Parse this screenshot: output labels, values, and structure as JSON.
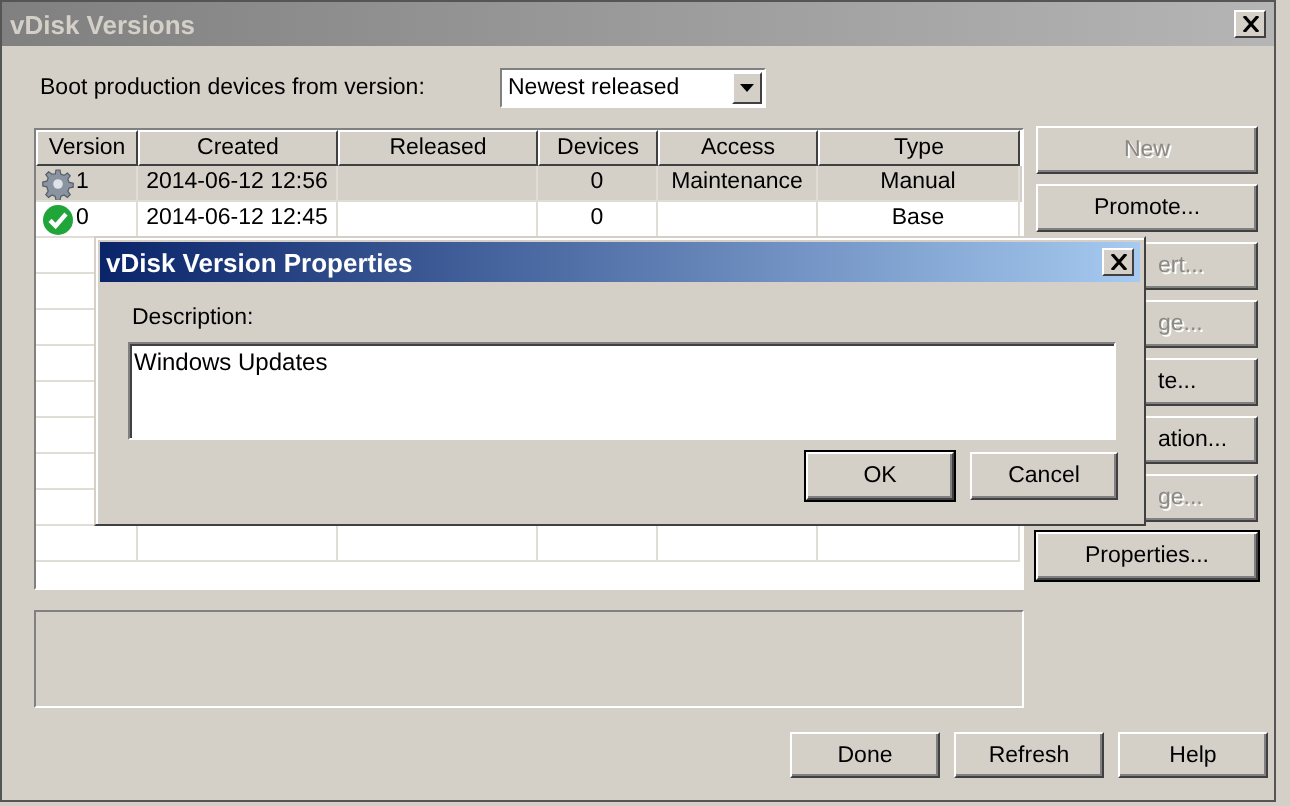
{
  "window": {
    "title": "vDisk Versions"
  },
  "boot": {
    "label": "Boot production devices from version:",
    "value": "Newest released"
  },
  "table": {
    "columns": [
      "Version",
      "Created",
      "Released",
      "Devices",
      "Access",
      "Type"
    ],
    "rows": [
      {
        "kind": "maintenance",
        "selected": true,
        "cells": [
          "1",
          "2014-06-12 12:56",
          "",
          "0",
          "Maintenance",
          "Manual"
        ]
      },
      {
        "kind": "production",
        "selected": false,
        "cells": [
          "0",
          "2014-06-12 12:45",
          "",
          "0",
          "",
          "Base"
        ]
      }
    ]
  },
  "side_buttons": [
    {
      "label": "New",
      "disabled": true
    },
    {
      "label": "Promote...",
      "disabled": false
    },
    {
      "label": "ert...",
      "disabled": true
    },
    {
      "label": "ge...",
      "disabled": true
    },
    {
      "label": "te...",
      "disabled": false
    },
    {
      "label": "ation...",
      "disabled": false
    },
    {
      "label": "ge...",
      "disabled": true
    },
    {
      "label": "Properties...",
      "disabled": false
    }
  ],
  "bottom_buttons": [
    "Done",
    "Refresh",
    "Help"
  ],
  "dialog": {
    "title": "vDisk Version Properties",
    "label": "Description:",
    "value": "Windows Updates",
    "buttons": [
      "OK",
      "Cancel"
    ]
  }
}
